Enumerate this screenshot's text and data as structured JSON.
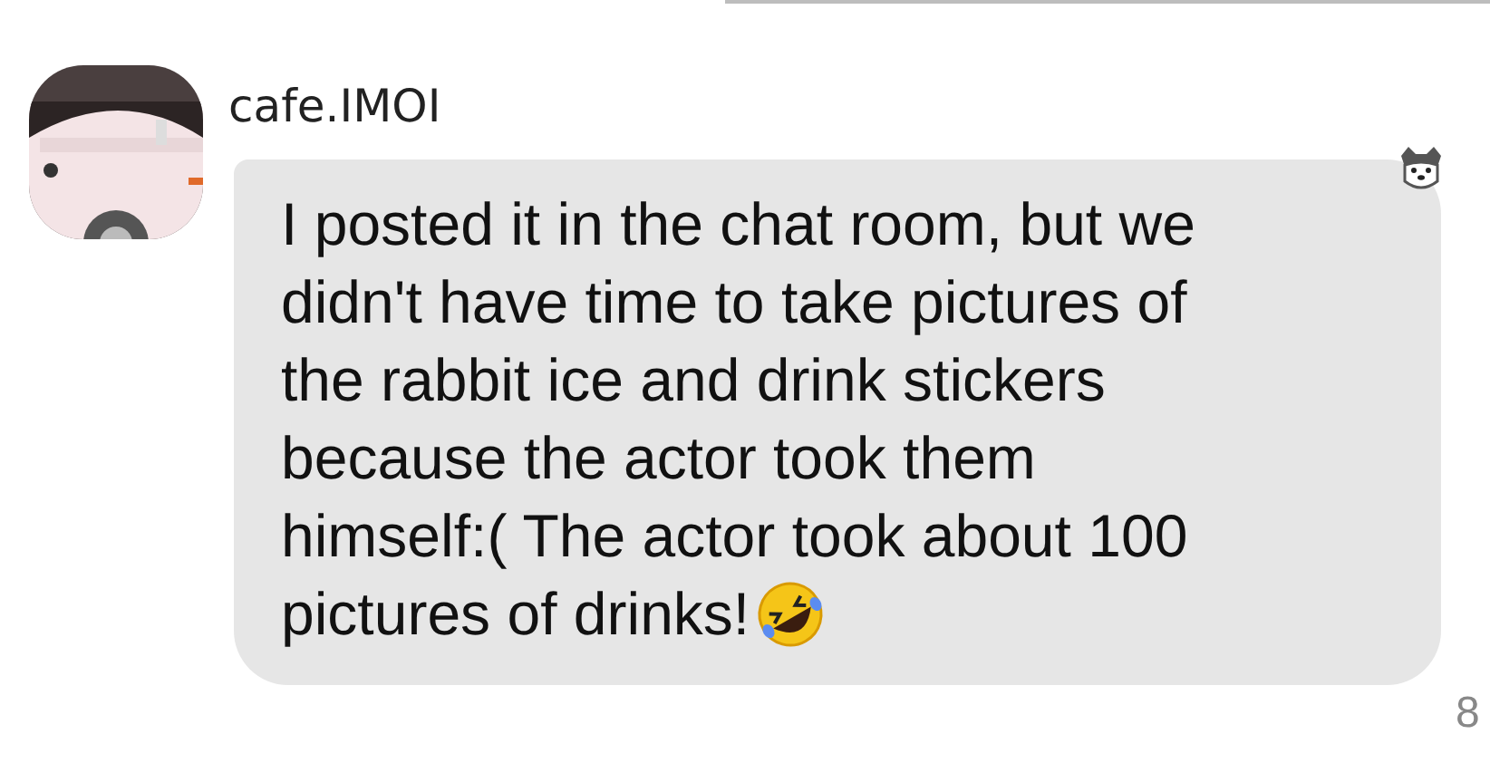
{
  "message": {
    "sender": "cafe.IMOI",
    "lines": [
      "I posted it in the chat room, but we",
      "didn't have time to take pictures of",
      "the rabbit ice and drink stickers",
      "because the actor took them",
      "himself:( The actor took about 100",
      "pictures of drinks!"
    ],
    "side_text": "8"
  }
}
